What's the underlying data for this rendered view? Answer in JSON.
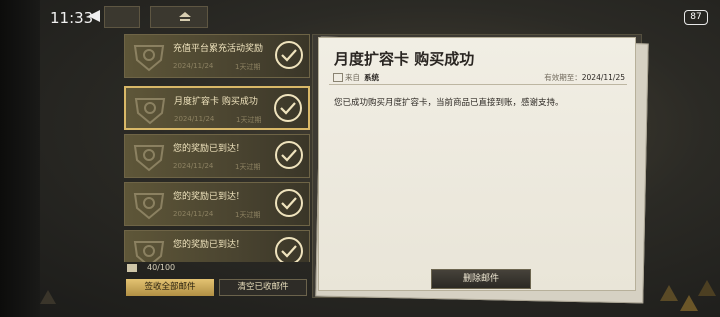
{
  "status_bar": {
    "time": "11:33",
    "battery": "87"
  },
  "mail_list": {
    "items": [
      {
        "title": "充值平台累充活动奖励",
        "date": "2024/11/24",
        "expire": "1天过期",
        "selected": false
      },
      {
        "title": "月度扩容卡 购买成功",
        "date": "2024/11/24",
        "expire": "1天过期",
        "selected": true
      },
      {
        "title": "您的奖励已到达!",
        "date": "2024/11/24",
        "expire": "1天过期",
        "selected": false
      },
      {
        "title": "您的奖励已到达!",
        "date": "2024/11/24",
        "expire": "1天过期",
        "selected": false
      },
      {
        "title": "您的奖励已到达!",
        "date": "",
        "expire": "",
        "selected": false
      }
    ],
    "count": "40/100",
    "collect_all_label": "签收全部邮件",
    "clear_read_label": "清空已收邮件"
  },
  "letter": {
    "title": "月度扩容卡 购买成功",
    "from_label": "来自",
    "from_name": "系统",
    "expiry_label": "有效期至：",
    "expiry_value": "2024/11/25",
    "body": "您已成功购买月度扩容卡，当前商品已直接到账，感谢支持。",
    "delete_label": "删除邮件"
  },
  "colors": {
    "accent_gold": "#d9b868",
    "paper": "#f1eee4"
  }
}
